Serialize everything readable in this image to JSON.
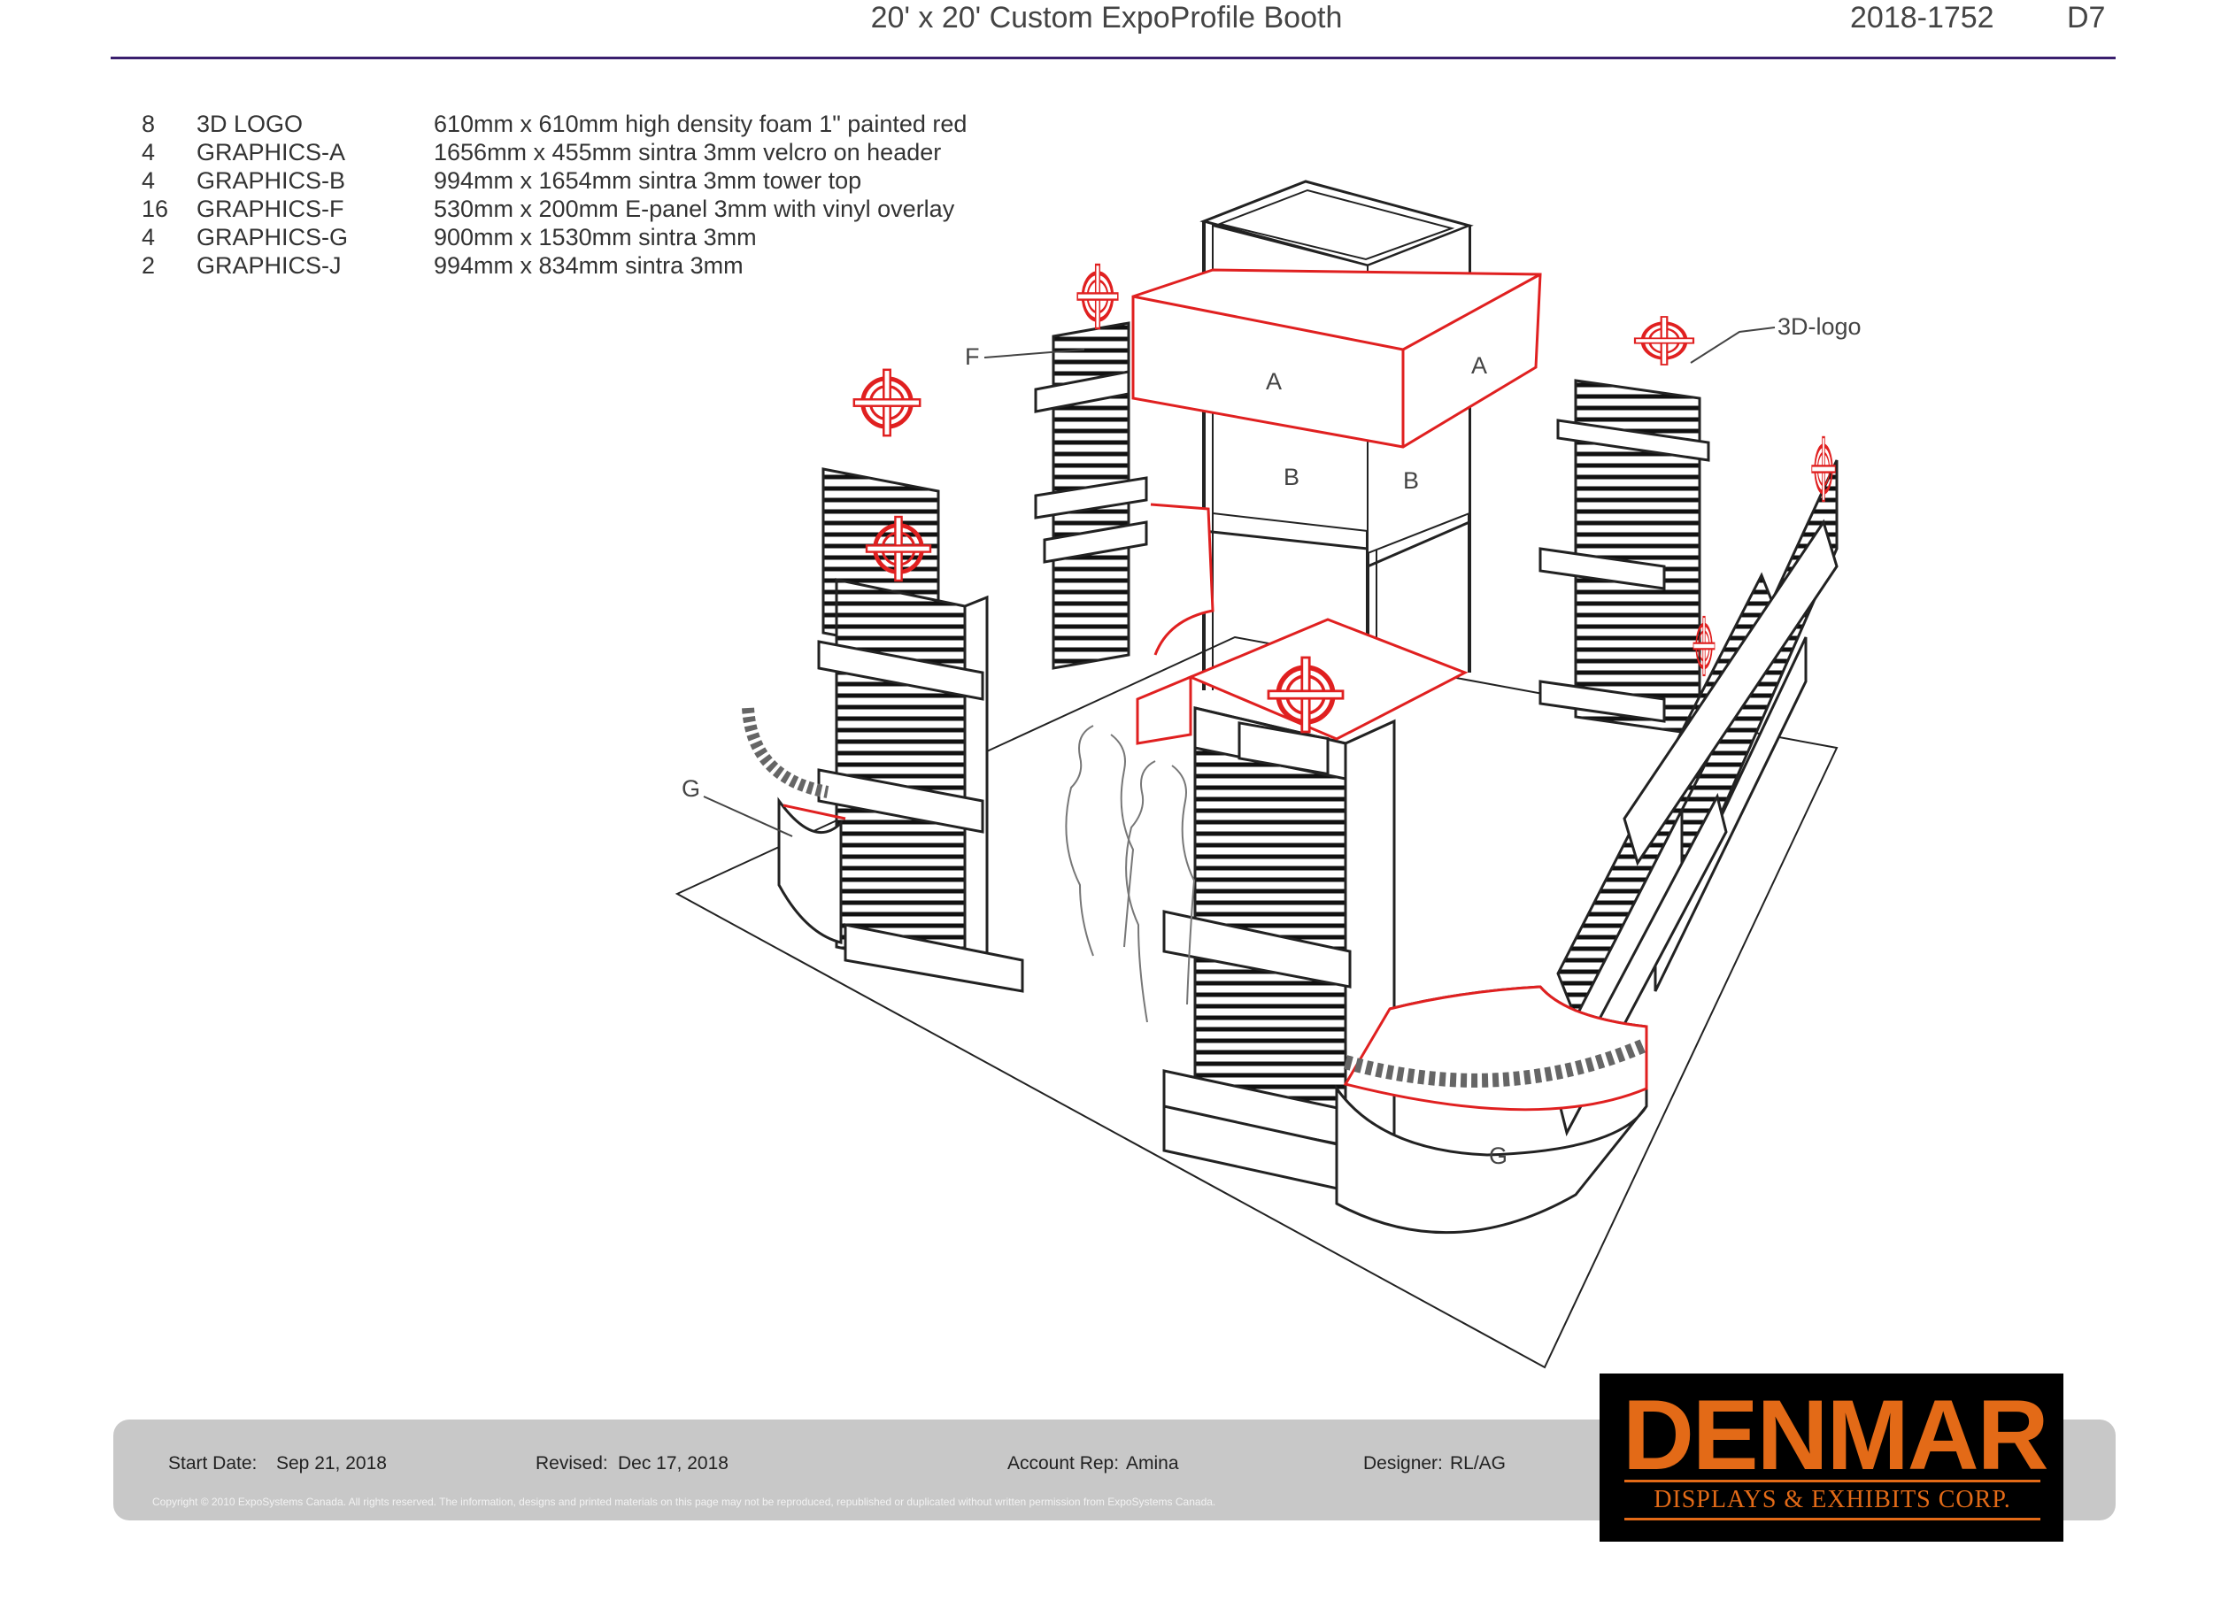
{
  "header": {
    "title": "20' x 20' Custom ExpoProfile Booth",
    "project_number": "2018-1752",
    "sheet": "D7"
  },
  "legend": [
    {
      "qty": "8",
      "name": "3D LOGO",
      "desc": "610mm x 610mm high density foam 1\" painted red"
    },
    {
      "qty": "4",
      "name": "GRAPHICS-A",
      "desc": "1656mm x 455mm sintra 3mm velcro on header"
    },
    {
      "qty": "4",
      "name": "GRAPHICS-B",
      "desc": "994mm x 1654mm sintra 3mm tower top"
    },
    {
      "qty": "16",
      "name": "GRAPHICS-F",
      "desc": "530mm x 200mm E-panel 3mm with vinyl overlay"
    },
    {
      "qty": "4",
      "name": "GRAPHICS-G",
      "desc": "900mm x 1530mm sintra 3mm"
    },
    {
      "qty": "2",
      "name": "GRAPHICS-J",
      "desc": "994mm x 834mm sintra 3mm"
    }
  ],
  "drawing_labels": {
    "a_front": "A",
    "a_side": "A",
    "b_front": "B",
    "b_side": "B",
    "f": "F",
    "g_left": "G",
    "g_front": "G",
    "logo_callout": "3D-logo"
  },
  "footer": {
    "start_label": "Start Date:",
    "start_value": "Sep 21, 2018",
    "revised_label": "Revised:",
    "revised_value": "Dec 17, 2018",
    "rep_label": "Account Rep:",
    "rep_value": "Amina",
    "designer_label": "Designer:",
    "designer_value": "RL/AG",
    "copyright": "Copyright © 2010 ExpoSystems Canada. All rights reserved. The information, designs and printed materials on this page may not be reproduced, republished or duplicated without written permission from ExpoSystems Canada."
  },
  "logo": {
    "wordmark": "DENMAR",
    "tagline": "DISPLAYS & EXHIBITS CORP.",
    "colors": {
      "accent": "#e36a17",
      "background": "#000000"
    }
  },
  "colors": {
    "rule": "#3a1f6e",
    "graphics_red": "#e02020",
    "footer_bar": "#c8c8c8"
  }
}
